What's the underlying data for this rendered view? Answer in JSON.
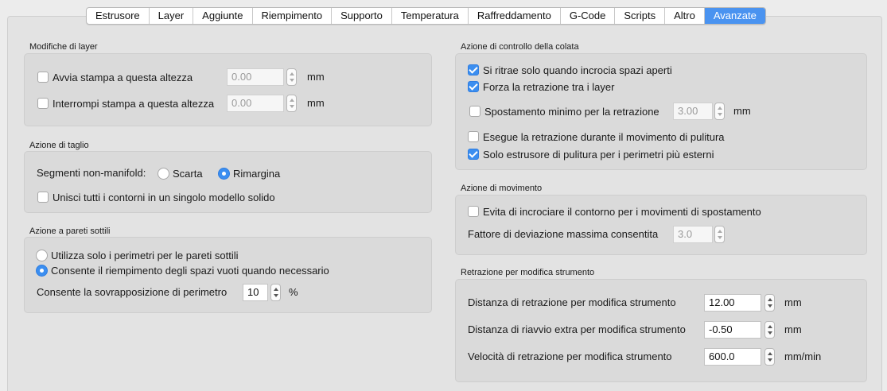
{
  "tabs": [
    "Estrusore",
    "Layer",
    "Aggiunte",
    "Riempimento",
    "Supporto",
    "Temperatura",
    "Raffreddamento",
    "G-Code",
    "Scripts",
    "Altro",
    "Avanzate"
  ],
  "active_tab": "Avanzate",
  "layer_changes": {
    "title": "Modifiche di layer",
    "start_label": "Avvia stampa a questa altezza",
    "start_value": "0.00",
    "start_unit": "mm",
    "pause_label": "Interrompi stampa a questa altezza",
    "pause_value": "0.00",
    "pause_unit": "mm"
  },
  "cut": {
    "title": "Azione di taglio",
    "nonmanifold_label": "Segmenti non-manifold:",
    "opt_discard": "Scarta",
    "opt_heal": "Rimargina",
    "merge_label": "Unisci tutti i contorni in un singolo modello solido"
  },
  "thin_walls": {
    "title": "Azione a pareti sottili",
    "opt_perimeters": "Utilizza solo i perimetri per le pareti sottili",
    "opt_fill": "Consente il riempimento degli spazi vuoti quando necessario",
    "overlap_label": "Consente la sovrapposizione di perimetro",
    "overlap_value": "10",
    "overlap_unit": "%"
  },
  "ooze": {
    "title": "Azione di controllo della colata",
    "retract_open": "Si ritrae solo quando incrocia spazi aperti",
    "force_retract": "Forza la retrazione tra i layer",
    "min_travel_label": "Spostamento minimo per la retrazione",
    "min_travel_value": "3.00",
    "min_travel_unit": "mm",
    "wipe_retract": "Esegue la retrazione durante il movimento di pulitura",
    "wipe_outer": "Solo estrusore di pulitura per i perimetri più esterni"
  },
  "movement": {
    "title": "Azione di movimento",
    "avoid_label": "Evita di incrociare il contorno per i movimenti di spostamento",
    "deviation_label": "Fattore di deviazione massima consentita",
    "deviation_value": "3.0"
  },
  "tool_change": {
    "title": "Retrazione per modifica strumento",
    "distance_label": "Distanza di retrazione per modifica strumento",
    "distance_value": "12.00",
    "distance_unit": "mm",
    "restart_label": "Distanza di riavvio extra per modifica strumento",
    "restart_value": "-0.50",
    "restart_unit": "mm",
    "speed_label": "Velocità di retrazione per modifica strumento",
    "speed_value": "600.0",
    "speed_unit": "mm/min"
  }
}
